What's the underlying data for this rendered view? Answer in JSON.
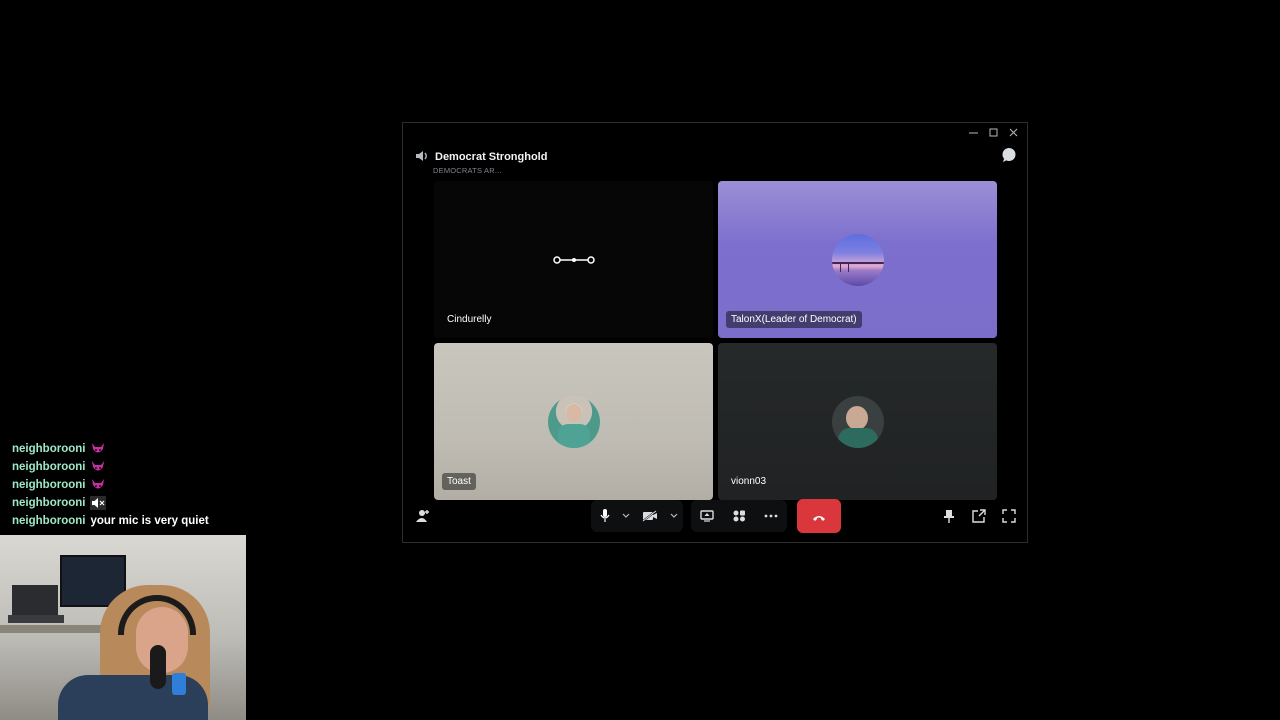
{
  "window": {
    "channel_name": "Democrat Stronghold",
    "channel_status": "DEMOCRATS AR...",
    "controls": {
      "minimize_icon": "minimize-icon",
      "maximize_icon": "maximize-icon",
      "close_icon": "close-icon"
    }
  },
  "participants": [
    {
      "name": "Cindurelly",
      "state": "connecting"
    },
    {
      "name": "TalonX(Leader of Democrat)",
      "state": "speaking"
    },
    {
      "name": "Toast",
      "state": "idle"
    },
    {
      "name": "vionn03",
      "state": "idle"
    }
  ],
  "toolbar": {
    "invite_icon": "add-user-icon",
    "mic_icon": "microphone-icon",
    "camera_icon": "camera-off-icon",
    "screen_share_icon": "screen-share-icon",
    "activities_icon": "activities-icon",
    "more_icon": "more-icon",
    "disconnect_icon": "phone-hangup-icon",
    "pin_icon": "pin-icon",
    "popout_icon": "popout-icon",
    "fullscreen_icon": "fullscreen-icon"
  },
  "chat": [
    {
      "user": "neighborooni",
      "message": "",
      "emote": "devil-emote"
    },
    {
      "user": "neighborooni",
      "message": "",
      "emote": "devil-emote"
    },
    {
      "user": "neighborooni",
      "message": "",
      "emote": "devil-emote"
    },
    {
      "user": "neighborooni",
      "message": "",
      "emote": "muted-speaker-emote"
    },
    {
      "user": "neighborooni",
      "message": "your mic is very quiet",
      "emote": ""
    }
  ],
  "colors": {
    "accent_red": "#da373c",
    "chat_username": "#9ee8c7",
    "tile_purple": "#7d6fcd",
    "window_bg": "#000000"
  }
}
